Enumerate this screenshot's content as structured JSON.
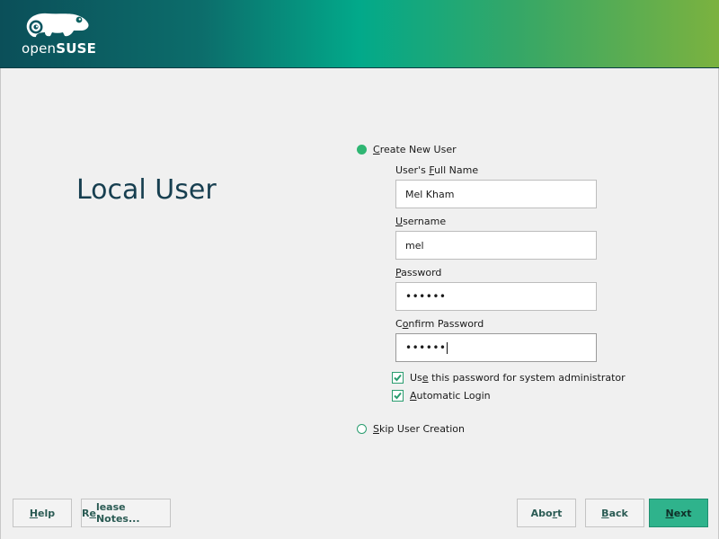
{
  "brand": {
    "logo_light": "open",
    "logo_bold": "SUSE",
    "gradient": [
      "#0b4f59",
      "#02a98a",
      "#7bb23f"
    ]
  },
  "page": {
    "title": "Local User"
  },
  "options": {
    "create_user": {
      "mnemonic": "C",
      "rest": "reate New User",
      "selected": true
    },
    "skip_user": {
      "mnemonic": "S",
      "rest": "kip User Creation",
      "selected": false
    }
  },
  "form": {
    "full_name": {
      "label_pre": "User's ",
      "label_mn": "F",
      "label_post": "ull Name",
      "value": "Mel Kham"
    },
    "username": {
      "label_pre": "",
      "label_mn": "U",
      "label_post": "sername",
      "value": "mel"
    },
    "password": {
      "label_pre": "",
      "label_mn": "P",
      "label_post": "assword",
      "value": "••••••"
    },
    "confirm": {
      "label_pre": "C",
      "label_mn": "o",
      "label_post": "nfirm Password",
      "value": "••••••"
    }
  },
  "checkboxes": {
    "admin_password": {
      "pre": "Us",
      "mn": "e",
      "post": " this password for system administrator",
      "checked": true
    },
    "autologin": {
      "pre": "",
      "mn": "A",
      "post": "utomatic Login",
      "checked": true
    }
  },
  "buttons": {
    "help": {
      "mn": "H",
      "rest": "elp"
    },
    "release_notes": {
      "pre": "R",
      "mn": "e",
      "rest": "lease Notes..."
    },
    "abort": {
      "pre": "Abo",
      "mn": "r",
      "rest": "t"
    },
    "back": {
      "mn": "B",
      "rest": "ack"
    },
    "next": {
      "mn": "N",
      "rest": "ext"
    }
  },
  "colors": {
    "accent": "#2fb673",
    "title": "#173f50",
    "primary_button": "#2fb38c"
  }
}
